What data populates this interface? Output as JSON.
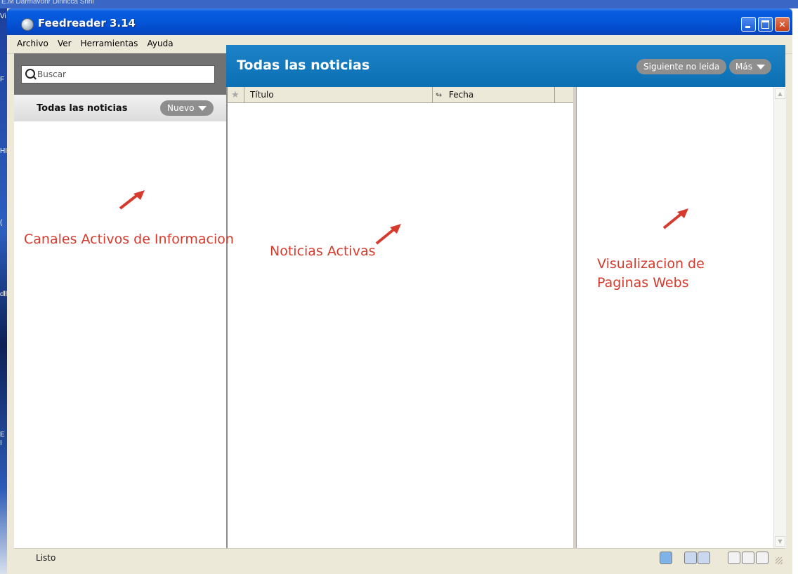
{
  "desktop": {
    "top_fragment": "E.M Darmavonr Dlnncca Srinl",
    "side_fragments": [
      "Vi",
      "F",
      "HI",
      "(",
      "dll",
      "E",
      "I"
    ]
  },
  "window": {
    "title": "Feedreader 3.14",
    "controls": {
      "minimize_icon": "minimize-icon",
      "maximize_icon": "maximize-icon",
      "close_icon": "close-icon"
    }
  },
  "menu": [
    "Archivo",
    "Ver",
    "Herramientas",
    "Ayuda"
  ],
  "sidebar": {
    "search_placeholder": "Buscar",
    "feeds_title": "Todas las noticias",
    "new_button": "Nuevo"
  },
  "main": {
    "title": "Todas las noticias",
    "next_unread_button": "Siguiente no leida",
    "more_button": "Más",
    "columns": {
      "title": "Título",
      "date": "Fecha"
    }
  },
  "annotations": {
    "channels": "Canales Activos de Informacion",
    "news": "Noticias Activas",
    "web_line1": "Visualizacion de",
    "web_line2": "Paginas Webs",
    "color": "#d63a2c"
  },
  "statusbar": {
    "text": "Listo"
  },
  "colors": {
    "titlebar": "#0455d8",
    "main_header": "#0b6fb3",
    "search_panel": "#727272",
    "pill": "#8e8e8e"
  }
}
